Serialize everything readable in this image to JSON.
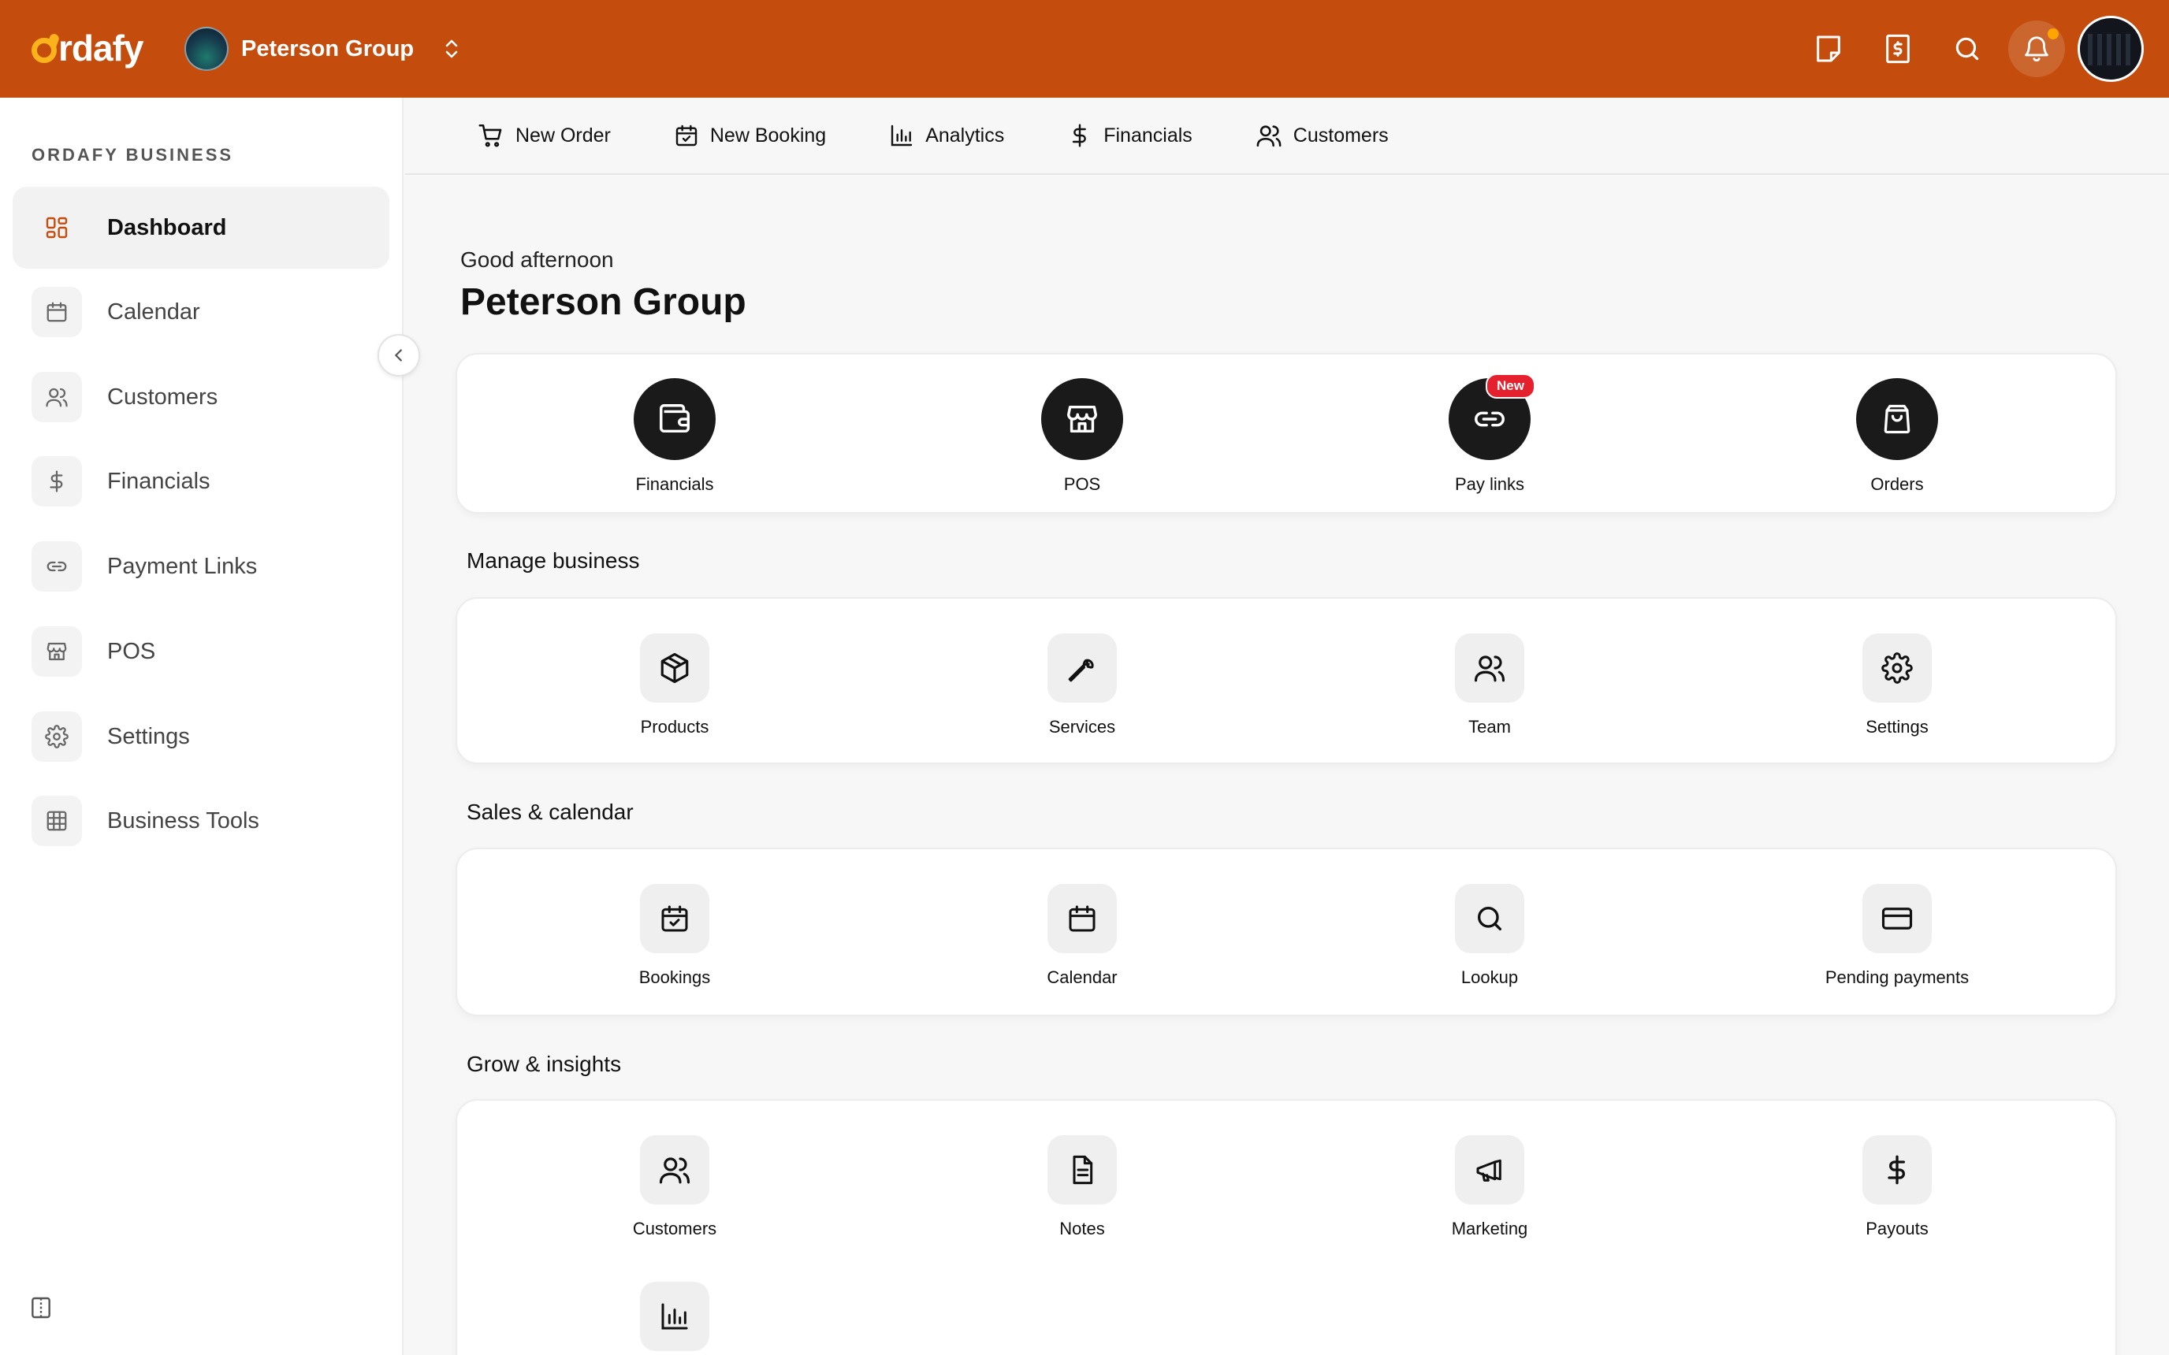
{
  "app": {
    "logo_text": "rdafy",
    "brand_color": "#c44d0d",
    "accent_color": "#fbb31b"
  },
  "header": {
    "org_name": "Peterson Group",
    "icons": [
      "note-icon",
      "receipt-icon",
      "search-icon",
      "bell-icon",
      "user-avatar"
    ]
  },
  "sidebar": {
    "heading": "ORDAFY BUSINESS",
    "items": [
      {
        "label": "Dashboard",
        "icon": "dashboard-icon",
        "active": true
      },
      {
        "label": "Calendar",
        "icon": "calendar-icon"
      },
      {
        "label": "Customers",
        "icon": "users-icon"
      },
      {
        "label": "Financials",
        "icon": "dollar-icon"
      },
      {
        "label": "Payment Links",
        "icon": "link-icon"
      },
      {
        "label": "POS",
        "icon": "store-icon"
      },
      {
        "label": "Settings",
        "icon": "gear-icon"
      },
      {
        "label": "Business Tools",
        "icon": "grid-icon"
      }
    ]
  },
  "quicknav": {
    "items": [
      {
        "label": "New Order",
        "icon": "cart-icon"
      },
      {
        "label": "New Booking",
        "icon": "calendar-check-icon"
      },
      {
        "label": "Analytics",
        "icon": "bar-chart-icon"
      },
      {
        "label": "Financials",
        "icon": "dollar-icon"
      },
      {
        "label": "Customers",
        "icon": "users-icon"
      }
    ]
  },
  "main": {
    "greeting": "Good afternoon",
    "title": "Peterson Group",
    "primary_tiles": [
      {
        "label": "Financials",
        "icon": "wallet-icon"
      },
      {
        "label": "POS",
        "icon": "store-icon"
      },
      {
        "label": "Pay links",
        "icon": "link-icon",
        "badge": "New"
      },
      {
        "label": "Orders",
        "icon": "bag-icon"
      }
    ],
    "sections": [
      {
        "title": "Manage business",
        "tiles": [
          {
            "label": "Products",
            "icon": "box-icon"
          },
          {
            "label": "Services",
            "icon": "wrench-icon"
          },
          {
            "label": "Team",
            "icon": "users-icon"
          },
          {
            "label": "Settings",
            "icon": "gear-icon"
          }
        ]
      },
      {
        "title": "Sales & calendar",
        "tiles": [
          {
            "label": "Bookings",
            "icon": "calendar-check-icon"
          },
          {
            "label": "Calendar",
            "icon": "calendar-icon"
          },
          {
            "label": "Lookup",
            "icon": "search-icon"
          },
          {
            "label": "Pending payments",
            "icon": "card-icon"
          }
        ]
      },
      {
        "title": "Grow & insights",
        "tiles": [
          {
            "label": "Customers",
            "icon": "users-icon"
          },
          {
            "label": "Notes",
            "icon": "document-icon"
          },
          {
            "label": "Marketing",
            "icon": "megaphone-icon"
          },
          {
            "label": "Payouts",
            "icon": "dollar-icon"
          },
          {
            "label": "",
            "icon": "bar-chart-icon"
          }
        ]
      }
    ]
  }
}
